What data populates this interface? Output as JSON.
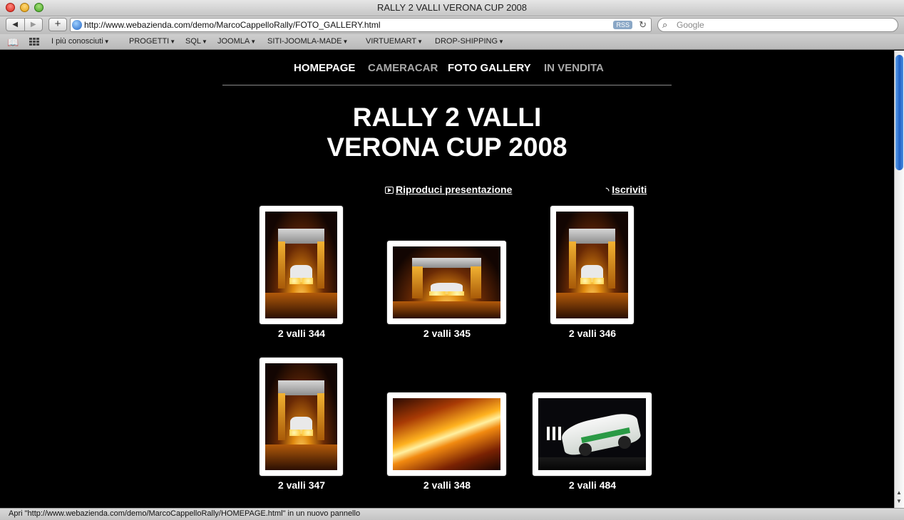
{
  "window": {
    "title": "RALLY 2 VALLI VERONA CUP 2008"
  },
  "toolbar": {
    "back": "◀",
    "forward": "▶",
    "add": "+",
    "url": "http://www.webazienda.com/demo/MarcoCappelloRally/FOTO_GALLERY.html",
    "rss": "RSS",
    "reload": "↻",
    "search_placeholder": "Google"
  },
  "bookmarks": [
    {
      "label": "I più conosciuti"
    },
    {
      "label": "PROGETTI"
    },
    {
      "label": "SQL"
    },
    {
      "label": "JOOMLA"
    },
    {
      "label": "SITI-JOOMLA-MADE"
    },
    {
      "label": "VIRTUEMART"
    },
    {
      "label": "DROP-SHIPPING"
    }
  ],
  "nav": {
    "items": [
      {
        "label": "HOMEPAGE",
        "state": "active"
      },
      {
        "label": "CAMERACAR",
        "state": "dim"
      },
      {
        "label": "FOTO GALLERY",
        "state": "active"
      },
      {
        "label": "IN VENDITA",
        "state": "dim"
      }
    ]
  },
  "page": {
    "title_line1": "RALLY 2 VALLI",
    "title_line2": "VERONA CUP 2008",
    "slideshow_label": "Riproduci presentazione",
    "subscribe_label": "Iscriviti"
  },
  "gallery": [
    {
      "caption": "2 valli 344",
      "orientation": "portrait",
      "scene": "arch"
    },
    {
      "caption": "2 valli 345",
      "orientation": "landscape",
      "scene": "arch"
    },
    {
      "caption": "2 valli 346",
      "orientation": "portrait",
      "scene": "arch"
    },
    {
      "caption": "2 valli 347",
      "orientation": "portrait",
      "scene": "arch"
    },
    {
      "caption": "2 valli 348",
      "orientation": "landscape",
      "scene": "streak"
    },
    {
      "caption": "2 valli 484",
      "orientation": "landscape",
      "scene": "car"
    }
  ],
  "status": {
    "text": "Apri \"http://www.webazienda.com/demo/MarcoCappelloRally/HOMEPAGE.html\" in un nuovo pannello"
  }
}
